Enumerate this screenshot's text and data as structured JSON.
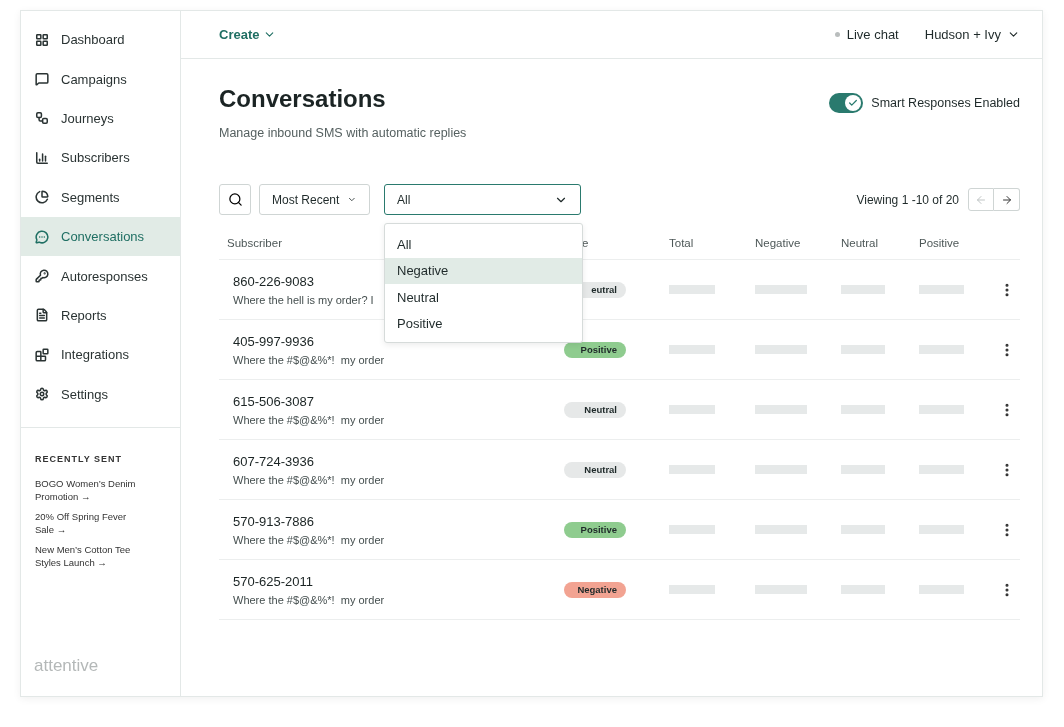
{
  "sidebar": {
    "nav": [
      {
        "label": "Dashboard",
        "selected": false
      },
      {
        "label": "Campaigns",
        "selected": false
      },
      {
        "label": "Journeys",
        "selected": false
      },
      {
        "label": "Subscribers",
        "selected": false
      },
      {
        "label": "Segments",
        "selected": false
      },
      {
        "label": "Conversations",
        "selected": true
      },
      {
        "label": "Autoresponses",
        "selected": false
      },
      {
        "label": "Reports",
        "selected": false
      },
      {
        "label": "Integrations",
        "selected": false
      },
      {
        "label": "Settings",
        "selected": false
      }
    ],
    "recently_sent": {
      "heading": "RECENTLY SENT",
      "items": [
        "BOGO Women’s Denim Promotion →",
        "20% Off Spring Fever Sale →",
        "New Men’s Cotton Tee Styles Launch →"
      ]
    },
    "logo": "attentive"
  },
  "topbar": {
    "create": "Create",
    "live_chat": "Live chat",
    "account": "Hudson + Ivy"
  },
  "page": {
    "title": "Conversations",
    "subtitle": "Manage inbound SMS with automatic replies",
    "toggle": {
      "label": "Smart Responses Enabled",
      "on": true
    }
  },
  "filters": {
    "sort": "Most Recent",
    "sentiment_filter": "All",
    "options": [
      {
        "label": "All",
        "selected": false
      },
      {
        "label": "Negative",
        "selected": true
      },
      {
        "label": "Neutral",
        "selected": false
      },
      {
        "label": "Positive",
        "selected": false
      }
    ],
    "pagination": "Viewing 1 -10 of 20",
    "prev_disabled": true
  },
  "table": {
    "columns": [
      "Subscriber",
      "e",
      "Total",
      "Negative",
      "Neutral",
      "Positive"
    ],
    "rows": [
      {
        "phone": "860-226-9083",
        "message": "Where the hell is my order? I",
        "sentiment": {
          "label": "eutral",
          "kind": "neutral"
        }
      },
      {
        "phone": "405-997-9936",
        "message": "Where the #$@&%*!  my order",
        "sentiment": {
          "label": "Positive",
          "kind": "positive"
        }
      },
      {
        "phone": "615-506-3087",
        "message": "Where the #$@&%*!  my order",
        "sentiment": {
          "label": "Neutral",
          "kind": "neutral"
        }
      },
      {
        "phone": "607-724-3936",
        "message": "Where the #$@&%*!  my order",
        "sentiment": {
          "label": "Neutral",
          "kind": "neutral"
        }
      },
      {
        "phone": "570-913-7886",
        "message": "Where the #$@&%*!  my order",
        "sentiment": {
          "label": "Positive",
          "kind": "positive"
        }
      },
      {
        "phone": "570-625-2011",
        "message": "Where the #$@&%*!  my order",
        "sentiment": {
          "label": "Negative",
          "kind": "negative"
        }
      }
    ]
  }
}
